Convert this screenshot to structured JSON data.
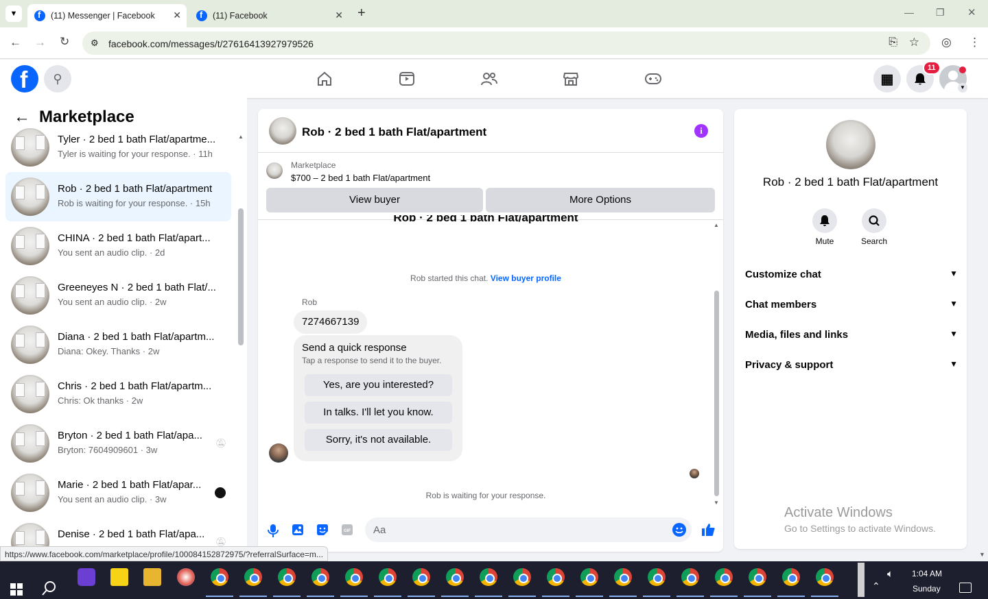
{
  "browser": {
    "tabs": [
      {
        "title": "(11) Messenger | Facebook",
        "active": true
      },
      {
        "title": "(11) Facebook",
        "active": false
      }
    ],
    "new_tab_glyph": "+",
    "url": "facebook.com/messages/t/27616413927979526",
    "status_url": "https://www.facebook.com/marketplace/profile/100084152872975/?referralSurface=m..."
  },
  "fbnav": {
    "notification_count": "11",
    "icons": [
      "home-icon",
      "video-icon",
      "friends-icon",
      "marketplace-icon",
      "gaming-icon"
    ]
  },
  "left": {
    "title": "Marketplace",
    "conversations": [
      {
        "name": "Tyler · 2 bed 1 bath Flat/apartme...",
        "sub": "Tyler is waiting for your response. · 11h",
        "selected": false,
        "indicator": ""
      },
      {
        "name": "Rob · 2 bed 1 bath Flat/apartment",
        "sub": "Rob is waiting for your response. · 15h",
        "selected": true,
        "indicator": ""
      },
      {
        "name": "CHINA · 2 bed 1 bath Flat/apart...",
        "sub": "You sent an audio clip. · 2d",
        "selected": false,
        "indicator": ""
      },
      {
        "name": "Greeneyes N · 2 bed 1 bath Flat/...",
        "sub": "You sent an audio clip. · 2w",
        "selected": false,
        "indicator": ""
      },
      {
        "name": "Diana · 2 bed 1 bath Flat/apartm...",
        "sub": "Diana: Okey. Thanks · 2w",
        "selected": false,
        "indicator": ""
      },
      {
        "name": "Chris · 2 bed 1 bath Flat/apartm...",
        "sub": "Chris: Ok thanks · 2w",
        "selected": false,
        "indicator": ""
      },
      {
        "name": "Bryton · 2 bed 1 bath Flat/apa...",
        "sub": "Bryton: 7604909601 · 3w",
        "selected": false,
        "indicator": "muted"
      },
      {
        "name": "Marie · 2 bed 1 bath Flat/apar...",
        "sub": "You sent an audio clip. · 3w",
        "selected": false,
        "indicator": "seen"
      },
      {
        "name": "Denise · 2 bed 1 bath Flat/apa...",
        "sub": "",
        "selected": false,
        "indicator": "muted"
      }
    ]
  },
  "chat": {
    "title": "Rob · 2 bed 1 bath Flat/apartment",
    "listing_source": "Marketplace",
    "listing_desc": "$700 – 2 bed 1 bath Flat/apartment",
    "view_buyer_label": "View buyer",
    "more_options_label": "More Options",
    "partial_heading": "Rob · 2 bed 1 bath Flat/apartment",
    "started_text": "Rob started this chat.",
    "view_profile_link": "View buyer profile",
    "sender_name": "Rob",
    "message": "7274667139",
    "quick_title": "Send a quick response",
    "quick_sub": "Tap a response to send it to the buyer.",
    "quick_options": [
      "Yes, are you interested?",
      "In talks. I'll let you know.",
      "Sorry, it's not available."
    ],
    "waiting_text": "Rob is waiting for your response.",
    "input_placeholder": "Aa"
  },
  "right": {
    "title": "Rob · 2 bed 1 bath Flat/apartment",
    "mute_label": "Mute",
    "search_label": "Search",
    "sections": [
      "Customize chat",
      "Chat members",
      "Media, files and links",
      "Privacy & support"
    ],
    "watermark_title": "Activate Windows",
    "watermark_sub": "Go to Settings to activate Windows."
  },
  "taskbar": {
    "time": "1:04 AM",
    "day": "Sunday"
  },
  "colors": {
    "fb_blue": "#0866ff",
    "selected_conv": "#ebf5ff",
    "info_purple": "#a033ff",
    "badge_red": "#e41e3f"
  }
}
